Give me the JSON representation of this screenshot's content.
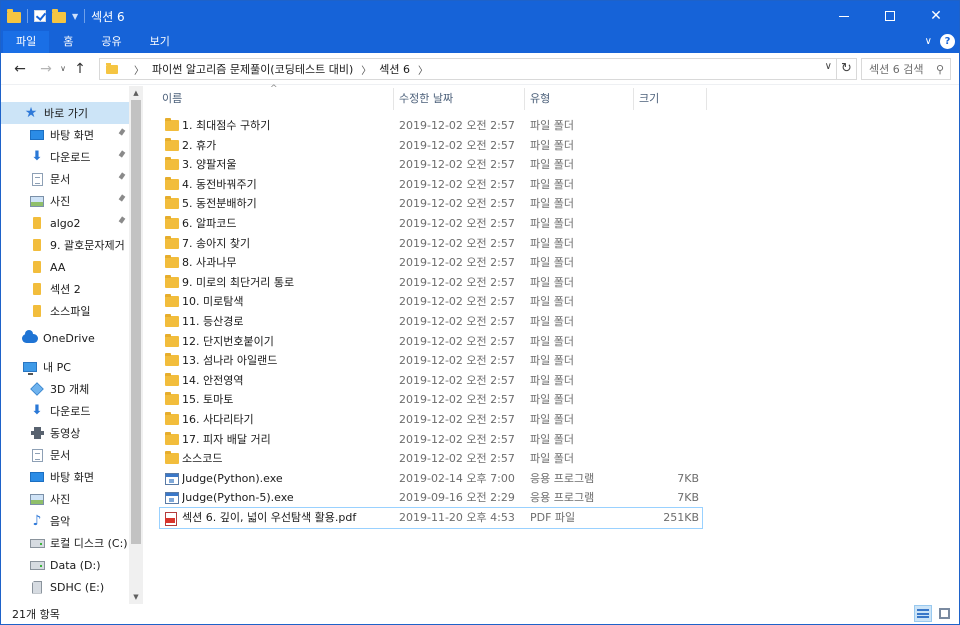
{
  "window": {
    "title": "섹션 6"
  },
  "ribbon": {
    "tabs": [
      "파일",
      "홈",
      "공유",
      "보기"
    ],
    "help": "?"
  },
  "address": {
    "crumbs": [
      "파이썬 알고리즘 문제풀이(코딩테스트 대비)",
      "섹션 6"
    ],
    "search_placeholder": "섹션 6 검색"
  },
  "sidebar": {
    "items": [
      {
        "label": "바로 가기",
        "icon": "star-icon",
        "pinned": false,
        "selected": true
      },
      {
        "label": "바탕 화면",
        "icon": "desktop-icon",
        "pinned": true
      },
      {
        "label": "다운로드",
        "icon": "download-icon",
        "pinned": true
      },
      {
        "label": "문서",
        "icon": "document-icon",
        "pinned": true
      },
      {
        "label": "사진",
        "icon": "pictures-icon",
        "pinned": true
      },
      {
        "label": "algo2",
        "icon": "folder-icon",
        "pinned": true
      },
      {
        "label": "9. 괄호문자제거",
        "icon": "folder-icon",
        "pinned": false
      },
      {
        "label": "AA",
        "icon": "folder-icon",
        "pinned": false
      },
      {
        "label": "섹션 2",
        "icon": "folder-icon",
        "pinned": false
      },
      {
        "label": "소스파일",
        "icon": "folder-icon",
        "pinned": false
      },
      {
        "label": "OneDrive",
        "icon": "onedrive-icon",
        "pinned": false
      },
      {
        "label": "내 PC",
        "icon": "pc-icon",
        "pinned": false
      },
      {
        "label": "3D 개체",
        "icon": "3d-objects-icon",
        "pinned": false
      },
      {
        "label": "다운로드",
        "icon": "download-icon",
        "pinned": false
      },
      {
        "label": "동영상",
        "icon": "video-icon",
        "pinned": false
      },
      {
        "label": "문서",
        "icon": "document-icon",
        "pinned": false
      },
      {
        "label": "바탕 화면",
        "icon": "desktop-icon",
        "pinned": false
      },
      {
        "label": "사진",
        "icon": "pictures-icon",
        "pinned": false
      },
      {
        "label": "음악",
        "icon": "music-icon",
        "pinned": false
      },
      {
        "label": "로컬 디스크 (C:)",
        "icon": "drive-icon",
        "pinned": false
      },
      {
        "label": "Data (D:)",
        "icon": "drive-icon",
        "pinned": false
      },
      {
        "label": "SDHC (E:)",
        "icon": "sd-card-icon",
        "pinned": false
      }
    ]
  },
  "columns": [
    "이름",
    "수정한 날짜",
    "유형",
    "크기"
  ],
  "files": [
    {
      "name": "1. 최대점수 구하기",
      "date": "2019-12-02 오전 2:57",
      "type": "파일 폴더",
      "size": "",
      "icon": "folder-icon"
    },
    {
      "name": "2. 휴가",
      "date": "2019-12-02 오전 2:57",
      "type": "파일 폴더",
      "size": "",
      "icon": "folder-icon"
    },
    {
      "name": "3. 양팔저울",
      "date": "2019-12-02 오전 2:57",
      "type": "파일 폴더",
      "size": "",
      "icon": "folder-icon"
    },
    {
      "name": "4. 동전바꿔주기",
      "date": "2019-12-02 오전 2:57",
      "type": "파일 폴더",
      "size": "",
      "icon": "folder-icon"
    },
    {
      "name": "5. 동전분배하기",
      "date": "2019-12-02 오전 2:57",
      "type": "파일 폴더",
      "size": "",
      "icon": "folder-icon"
    },
    {
      "name": "6. 알파코드",
      "date": "2019-12-02 오전 2:57",
      "type": "파일 폴더",
      "size": "",
      "icon": "folder-icon"
    },
    {
      "name": "7. 송아지 찾기",
      "date": "2019-12-02 오전 2:57",
      "type": "파일 폴더",
      "size": "",
      "icon": "folder-icon"
    },
    {
      "name": "8. 사과나무",
      "date": "2019-12-02 오전 2:57",
      "type": "파일 폴더",
      "size": "",
      "icon": "folder-icon"
    },
    {
      "name": "9. 미로의 최단거리 통로",
      "date": "2019-12-02 오전 2:57",
      "type": "파일 폴더",
      "size": "",
      "icon": "folder-icon"
    },
    {
      "name": "10. 미로탐색",
      "date": "2019-12-02 오전 2:57",
      "type": "파일 폴더",
      "size": "",
      "icon": "folder-icon"
    },
    {
      "name": "11. 등산경로",
      "date": "2019-12-02 오전 2:57",
      "type": "파일 폴더",
      "size": "",
      "icon": "folder-icon"
    },
    {
      "name": "12. 단지번호붙이기",
      "date": "2019-12-02 오전 2:57",
      "type": "파일 폴더",
      "size": "",
      "icon": "folder-icon"
    },
    {
      "name": "13. 섬나라 아일랜드",
      "date": "2019-12-02 오전 2:57",
      "type": "파일 폴더",
      "size": "",
      "icon": "folder-icon"
    },
    {
      "name": "14. 안전영역",
      "date": "2019-12-02 오전 2:57",
      "type": "파일 폴더",
      "size": "",
      "icon": "folder-icon"
    },
    {
      "name": "15. 토마토",
      "date": "2019-12-02 오전 2:57",
      "type": "파일 폴더",
      "size": "",
      "icon": "folder-icon"
    },
    {
      "name": "16. 사다리타기",
      "date": "2019-12-02 오전 2:57",
      "type": "파일 폴더",
      "size": "",
      "icon": "folder-icon"
    },
    {
      "name": "17. 피자 배달 거리",
      "date": "2019-12-02 오전 2:57",
      "type": "파일 폴더",
      "size": "",
      "icon": "folder-icon"
    },
    {
      "name": "소스코드",
      "date": "2019-12-02 오전 2:57",
      "type": "파일 폴더",
      "size": "",
      "icon": "folder-icon"
    },
    {
      "name": "Judge(Python).exe",
      "date": "2019-02-14 오후 7:00",
      "type": "응용 프로그램",
      "size": "7KB",
      "icon": "exe-icon"
    },
    {
      "name": "Judge(Python-5).exe",
      "date": "2019-09-16 오전 2:29",
      "type": "응용 프로그램",
      "size": "7KB",
      "icon": "exe-icon"
    },
    {
      "name": "섹션 6. 깊이, 넓이 우선탐색 활용.pdf",
      "date": "2019-11-20 오후 4:53",
      "type": "PDF 파일",
      "size": "251KB",
      "icon": "pdf-icon",
      "selected": true
    }
  ],
  "status": {
    "item_count": "21개 항목"
  },
  "colors": {
    "titlebar": "#1663d8",
    "selection": "#cce4f7",
    "selection_border": "#99d1ff",
    "folder": "#f2bd3c"
  }
}
